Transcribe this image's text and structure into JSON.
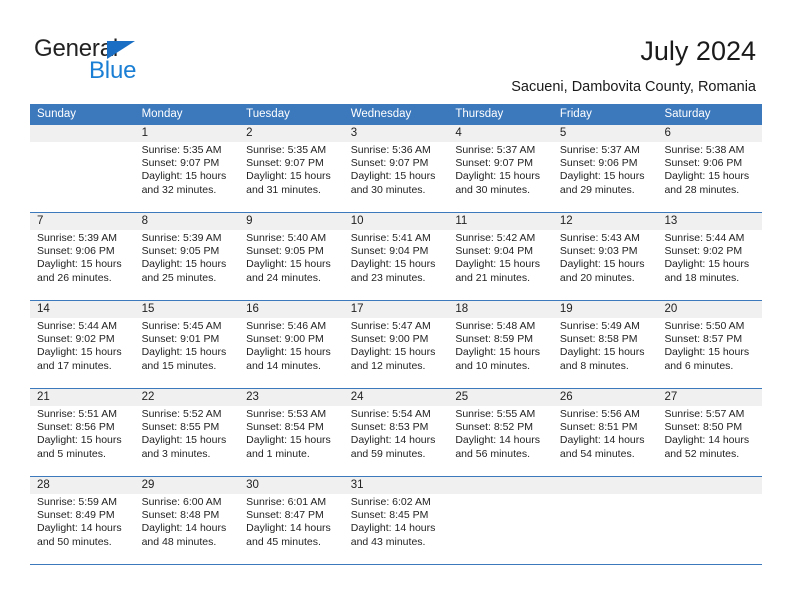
{
  "brand": {
    "name_top": "General",
    "name_bottom": "Blue",
    "triangle_color": "#1a6fc4",
    "blue_text_color": "#1a7fd4"
  },
  "header": {
    "title": "July 2024",
    "subtitle": "Sacueni, Dambovita County, Romania"
  },
  "theme": {
    "header_bg": "#3c78bc",
    "header_text": "#ffffff",
    "daynum_bg": "#f0f0f0",
    "cell_bg": "#ffffff",
    "rule_color": "#3c78bc"
  },
  "weekdays": [
    "Sunday",
    "Monday",
    "Tuesday",
    "Wednesday",
    "Thursday",
    "Friday",
    "Saturday"
  ],
  "weeks": [
    {
      "days": [
        {
          "num": "",
          "lines": []
        },
        {
          "num": "1",
          "lines": [
            "Sunrise: 5:35 AM",
            "Sunset: 9:07 PM",
            "Daylight: 15 hours",
            "and 32 minutes."
          ]
        },
        {
          "num": "2",
          "lines": [
            "Sunrise: 5:35 AM",
            "Sunset: 9:07 PM",
            "Daylight: 15 hours",
            "and 31 minutes."
          ]
        },
        {
          "num": "3",
          "lines": [
            "Sunrise: 5:36 AM",
            "Sunset: 9:07 PM",
            "Daylight: 15 hours",
            "and 30 minutes."
          ]
        },
        {
          "num": "4",
          "lines": [
            "Sunrise: 5:37 AM",
            "Sunset: 9:07 PM",
            "Daylight: 15 hours",
            "and 30 minutes."
          ]
        },
        {
          "num": "5",
          "lines": [
            "Sunrise: 5:37 AM",
            "Sunset: 9:06 PM",
            "Daylight: 15 hours",
            "and 29 minutes."
          ]
        },
        {
          "num": "6",
          "lines": [
            "Sunrise: 5:38 AM",
            "Sunset: 9:06 PM",
            "Daylight: 15 hours",
            "and 28 minutes."
          ]
        }
      ]
    },
    {
      "days": [
        {
          "num": "7",
          "lines": [
            "Sunrise: 5:39 AM",
            "Sunset: 9:06 PM",
            "Daylight: 15 hours",
            "and 26 minutes."
          ]
        },
        {
          "num": "8",
          "lines": [
            "Sunrise: 5:39 AM",
            "Sunset: 9:05 PM",
            "Daylight: 15 hours",
            "and 25 minutes."
          ]
        },
        {
          "num": "9",
          "lines": [
            "Sunrise: 5:40 AM",
            "Sunset: 9:05 PM",
            "Daylight: 15 hours",
            "and 24 minutes."
          ]
        },
        {
          "num": "10",
          "lines": [
            "Sunrise: 5:41 AM",
            "Sunset: 9:04 PM",
            "Daylight: 15 hours",
            "and 23 minutes."
          ]
        },
        {
          "num": "11",
          "lines": [
            "Sunrise: 5:42 AM",
            "Sunset: 9:04 PM",
            "Daylight: 15 hours",
            "and 21 minutes."
          ]
        },
        {
          "num": "12",
          "lines": [
            "Sunrise: 5:43 AM",
            "Sunset: 9:03 PM",
            "Daylight: 15 hours",
            "and 20 minutes."
          ]
        },
        {
          "num": "13",
          "lines": [
            "Sunrise: 5:44 AM",
            "Sunset: 9:02 PM",
            "Daylight: 15 hours",
            "and 18 minutes."
          ]
        }
      ]
    },
    {
      "days": [
        {
          "num": "14",
          "lines": [
            "Sunrise: 5:44 AM",
            "Sunset: 9:02 PM",
            "Daylight: 15 hours",
            "and 17 minutes."
          ]
        },
        {
          "num": "15",
          "lines": [
            "Sunrise: 5:45 AM",
            "Sunset: 9:01 PM",
            "Daylight: 15 hours",
            "and 15 minutes."
          ]
        },
        {
          "num": "16",
          "lines": [
            "Sunrise: 5:46 AM",
            "Sunset: 9:00 PM",
            "Daylight: 15 hours",
            "and 14 minutes."
          ]
        },
        {
          "num": "17",
          "lines": [
            "Sunrise: 5:47 AM",
            "Sunset: 9:00 PM",
            "Daylight: 15 hours",
            "and 12 minutes."
          ]
        },
        {
          "num": "18",
          "lines": [
            "Sunrise: 5:48 AM",
            "Sunset: 8:59 PM",
            "Daylight: 15 hours",
            "and 10 minutes."
          ]
        },
        {
          "num": "19",
          "lines": [
            "Sunrise: 5:49 AM",
            "Sunset: 8:58 PM",
            "Daylight: 15 hours",
            "and 8 minutes."
          ]
        },
        {
          "num": "20",
          "lines": [
            "Sunrise: 5:50 AM",
            "Sunset: 8:57 PM",
            "Daylight: 15 hours",
            "and 6 minutes."
          ]
        }
      ]
    },
    {
      "days": [
        {
          "num": "21",
          "lines": [
            "Sunrise: 5:51 AM",
            "Sunset: 8:56 PM",
            "Daylight: 15 hours",
            "and 5 minutes."
          ]
        },
        {
          "num": "22",
          "lines": [
            "Sunrise: 5:52 AM",
            "Sunset: 8:55 PM",
            "Daylight: 15 hours",
            "and 3 minutes."
          ]
        },
        {
          "num": "23",
          "lines": [
            "Sunrise: 5:53 AM",
            "Sunset: 8:54 PM",
            "Daylight: 15 hours",
            "and 1 minute."
          ]
        },
        {
          "num": "24",
          "lines": [
            "Sunrise: 5:54 AM",
            "Sunset: 8:53 PM",
            "Daylight: 14 hours",
            "and 59 minutes."
          ]
        },
        {
          "num": "25",
          "lines": [
            "Sunrise: 5:55 AM",
            "Sunset: 8:52 PM",
            "Daylight: 14 hours",
            "and 56 minutes."
          ]
        },
        {
          "num": "26",
          "lines": [
            "Sunrise: 5:56 AM",
            "Sunset: 8:51 PM",
            "Daylight: 14 hours",
            "and 54 minutes."
          ]
        },
        {
          "num": "27",
          "lines": [
            "Sunrise: 5:57 AM",
            "Sunset: 8:50 PM",
            "Daylight: 14 hours",
            "and 52 minutes."
          ]
        }
      ]
    },
    {
      "days": [
        {
          "num": "28",
          "lines": [
            "Sunrise: 5:59 AM",
            "Sunset: 8:49 PM",
            "Daylight: 14 hours",
            "and 50 minutes."
          ]
        },
        {
          "num": "29",
          "lines": [
            "Sunrise: 6:00 AM",
            "Sunset: 8:48 PM",
            "Daylight: 14 hours",
            "and 48 minutes."
          ]
        },
        {
          "num": "30",
          "lines": [
            "Sunrise: 6:01 AM",
            "Sunset: 8:47 PM",
            "Daylight: 14 hours",
            "and 45 minutes."
          ]
        },
        {
          "num": "31",
          "lines": [
            "Sunrise: 6:02 AM",
            "Sunset: 8:45 PM",
            "Daylight: 14 hours",
            "and 43 minutes."
          ]
        },
        {
          "num": "",
          "lines": []
        },
        {
          "num": "",
          "lines": []
        },
        {
          "num": "",
          "lines": []
        }
      ]
    }
  ]
}
